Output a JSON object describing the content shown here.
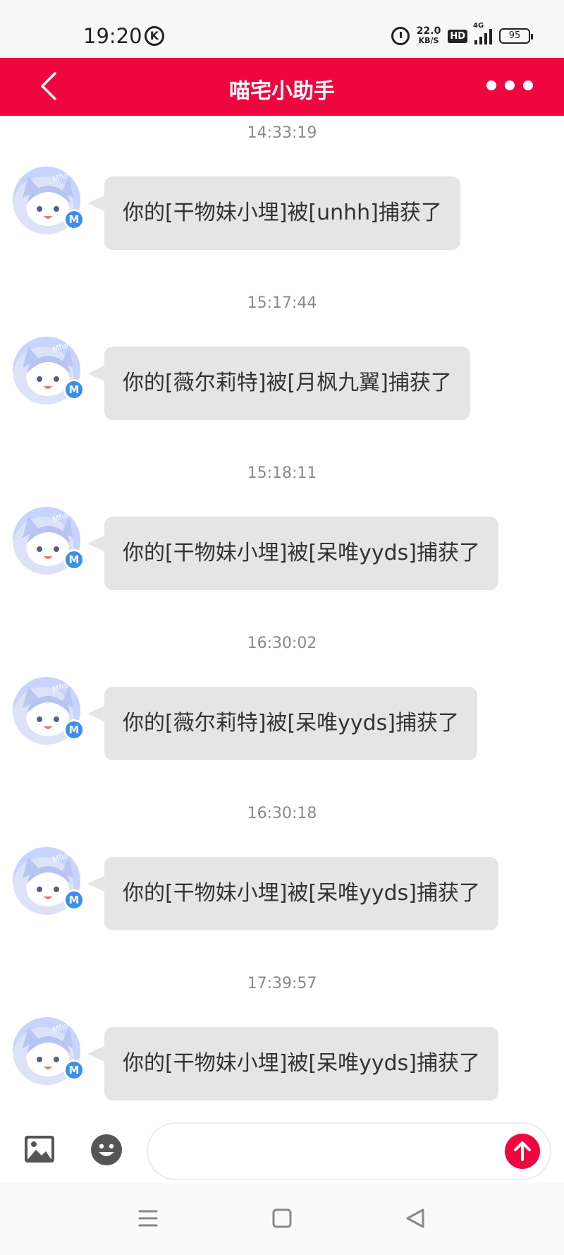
{
  "status_bar": {
    "time": "19:20",
    "k_icon": "K",
    "net_speed_value": "22.0",
    "net_speed_unit": "KB/S",
    "hd_label": "HD",
    "signal_label": "4G",
    "battery_level": "95"
  },
  "header": {
    "title": "喵宅小助手",
    "back_icon": "chevron-left-icon",
    "more_icon": "more-dots-icon"
  },
  "avatar": {
    "badge_label": "M",
    "brand_text": "Mfuns"
  },
  "messages": [
    {
      "time": "14:33:19",
      "text": "你的[干物妹小埋]被[unhh]捕获了"
    },
    {
      "time": "15:17:44",
      "text": "你的[薇尔莉特]被[月枫九翼]捕获了"
    },
    {
      "time": "15:18:11",
      "text": "你的[干物妹小埋]被[呆唯yyds]捕获了"
    },
    {
      "time": "16:30:02",
      "text": "你的[薇尔莉特]被[呆唯yyds]捕获了"
    },
    {
      "time": "16:30:18",
      "text": "你的[干物妹小埋]被[呆唯yyds]捕获了"
    },
    {
      "time": "17:39:57",
      "text": "你的[干物妹小埋]被[呆唯yyds]捕获了"
    }
  ],
  "input_bar": {
    "image_icon": "image-icon",
    "emoji_icon": "emoji-icon",
    "placeholder": "",
    "value": "",
    "send_icon": "arrow-up-icon"
  },
  "colors": {
    "accent": "#f0063f",
    "bubble": "#e5e5e5",
    "badge": "#3a8ef0"
  }
}
